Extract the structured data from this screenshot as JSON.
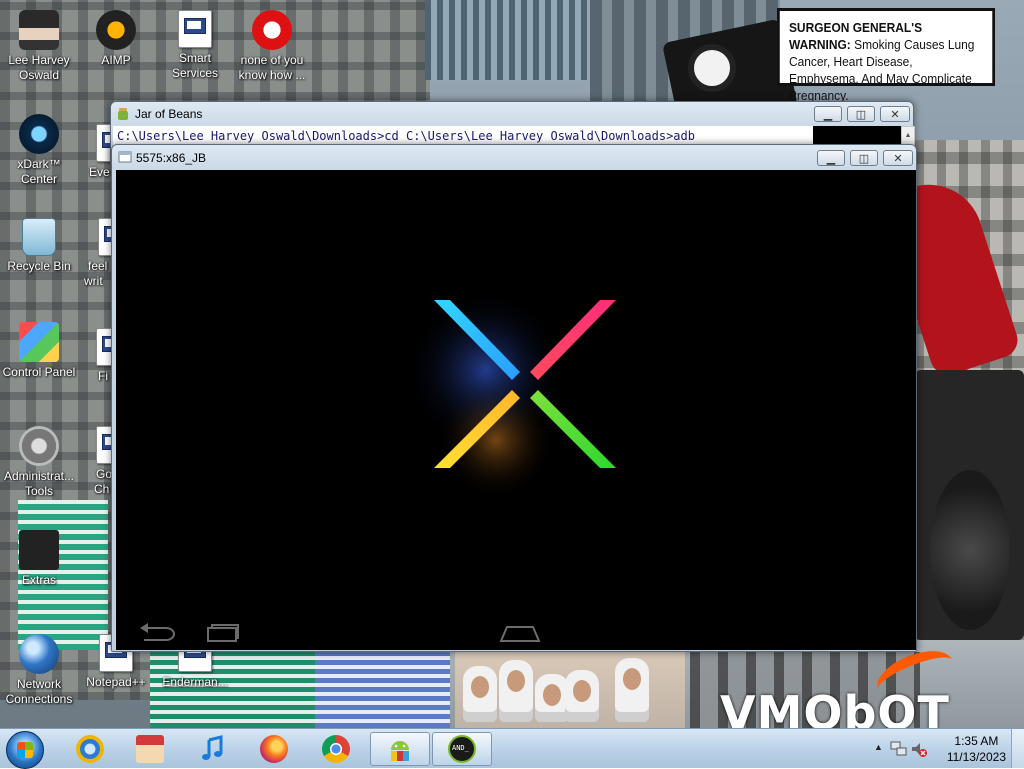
{
  "desktop": {
    "icons": [
      {
        "label": "Lee Harvey Oswald",
        "icon": "person-icon"
      },
      {
        "label": "AIMP",
        "icon": "aimp-icon"
      },
      {
        "label": "Smart Services",
        "icon": "file-icon"
      },
      {
        "label": "none of you know how ...",
        "icon": "record-icon"
      },
      {
        "label": "xDark™ Center",
        "icon": "xdark-icon"
      },
      {
        "label": "Eve",
        "icon": "file-icon"
      },
      {
        "label": "Recycle Bin",
        "icon": "recycle-bin-icon"
      },
      {
        "label": "feel writ",
        "icon": "file-icon"
      },
      {
        "label": "Control Panel",
        "icon": "control-panel-icon"
      },
      {
        "label": "Fi",
        "icon": "file-icon"
      },
      {
        "label": "Administrat... Tools",
        "icon": "admin-tools-icon"
      },
      {
        "label": "Go Ch",
        "icon": "file-icon"
      },
      {
        "label": "Extras",
        "icon": "extras-icon"
      },
      {
        "label": "Network Connections",
        "icon": "network-icon"
      },
      {
        "label": "Notepad++",
        "icon": "notepad-icon"
      },
      {
        "label": "Enderman...",
        "icon": "file-icon"
      }
    ],
    "warning_title": "SURGEON GENERAL'S WARNING:",
    "warning_text": "Smoking Causes Lung Cancer, Heart Disease, Emphysema, And May Complicate Pregnancy.",
    "watermark": "VMObOT"
  },
  "jar_window": {
    "title": "Jar of Beans",
    "console_text": "C:\\Users\\Lee Harvey Oswald\\Downloads>cd C:\\Users\\Lee Harvey Oswald\\Downloads>adb"
  },
  "emu_window": {
    "title": "5575:x86_JB",
    "boot_logo": "nexus-x-logo"
  },
  "taskbar": {
    "apps": [
      {
        "name": "internet-explorer",
        "active": false
      },
      {
        "name": "store",
        "active": false
      },
      {
        "name": "music",
        "active": false
      },
      {
        "name": "firefox",
        "active": false
      },
      {
        "name": "chrome",
        "active": false
      },
      {
        "name": "jar-of-beans",
        "active": true
      },
      {
        "name": "android-emulator",
        "active": true
      }
    ],
    "and_label": "AND_",
    "time": "1:35 AM",
    "date": "11/13/2023"
  },
  "colors": {
    "nexus_cyan": "#33d6ff",
    "nexus_pink": "#ff2d7a",
    "nexus_yellow": "#ffe033",
    "nexus_green": "#3ddc3d"
  }
}
